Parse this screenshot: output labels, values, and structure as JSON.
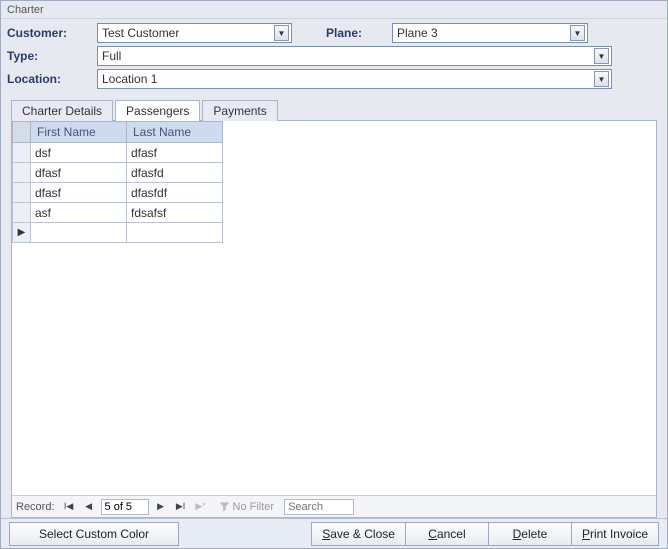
{
  "window": {
    "title": "Charter"
  },
  "labels": {
    "customer": "Customer:",
    "plane": "Plane:",
    "type": "Type:",
    "location": "Location:"
  },
  "fields": {
    "customer": "Test Customer",
    "plane": "Plane 3",
    "type": "Full",
    "location": "Location 1"
  },
  "tabs": [
    "Charter Details",
    "Passengers",
    "Payments"
  ],
  "passengers": {
    "columns": {
      "first_name": "First Name",
      "last_name": "Last Name"
    },
    "rows": [
      {
        "first": "dsf",
        "last": "dfasf"
      },
      {
        "first": "dfasf",
        "last": "dfasfd"
      },
      {
        "first": "dfasf",
        "last": "dfasfdf"
      },
      {
        "first": "asf",
        "last": "fdsafsf"
      }
    ]
  },
  "recordnav": {
    "label": "Record:",
    "position": "5 of 5",
    "filter": "No Filter",
    "search_placeholder": "Search"
  },
  "buttons": {
    "color": "Select Custom Color",
    "save_prefix": "S",
    "save_rest": "ave & Close",
    "cancel_prefix": "C",
    "cancel_rest": "ancel",
    "delete_prefix": "D",
    "delete_rest": "elete",
    "print_prefix": "P",
    "print_rest": "rint Invoice"
  }
}
